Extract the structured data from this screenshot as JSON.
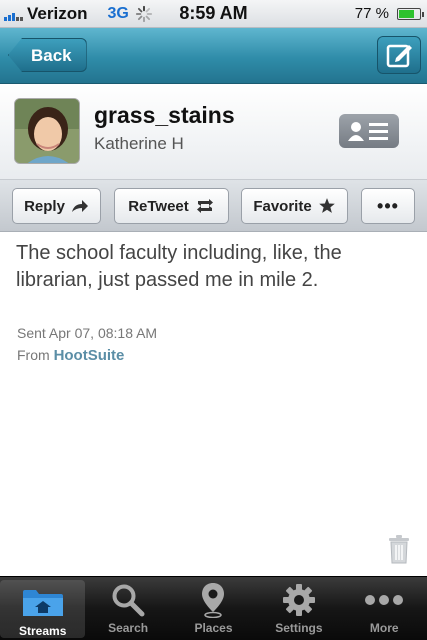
{
  "status_bar": {
    "carrier": "Verizon",
    "network": "3G",
    "time": "8:59 AM",
    "battery_percent": "77 %",
    "battery_level": 0.77
  },
  "nav": {
    "back_label": "Back",
    "compose_icon": "compose-icon"
  },
  "profile": {
    "username": "grass_stains",
    "full_name": "Katherine H"
  },
  "actions": {
    "reply": "Reply",
    "retweet": "ReTweet",
    "favorite": "Favorite",
    "more": "•••"
  },
  "tweet": {
    "text": "The school faculty including, like, the librarian, just passed me in mile 2.",
    "sent": "Sent Apr 07, 08:18 AM",
    "from_prefix": "From",
    "source": "HootSuite"
  },
  "tabs": [
    {
      "label": "Streams",
      "icon": "folder-icon",
      "active": true
    },
    {
      "label": "Search",
      "icon": "search-icon",
      "active": false
    },
    {
      "label": "Places",
      "icon": "location-pin-icon",
      "active": false
    },
    {
      "label": "Settings",
      "icon": "gear-icon",
      "active": false
    },
    {
      "label": "More",
      "icon": "more-dots-icon",
      "active": false
    }
  ],
  "colors": {
    "nav_accent": "#2f8ca9",
    "link": "#5b8ea6",
    "network": "#1a6fd0"
  }
}
